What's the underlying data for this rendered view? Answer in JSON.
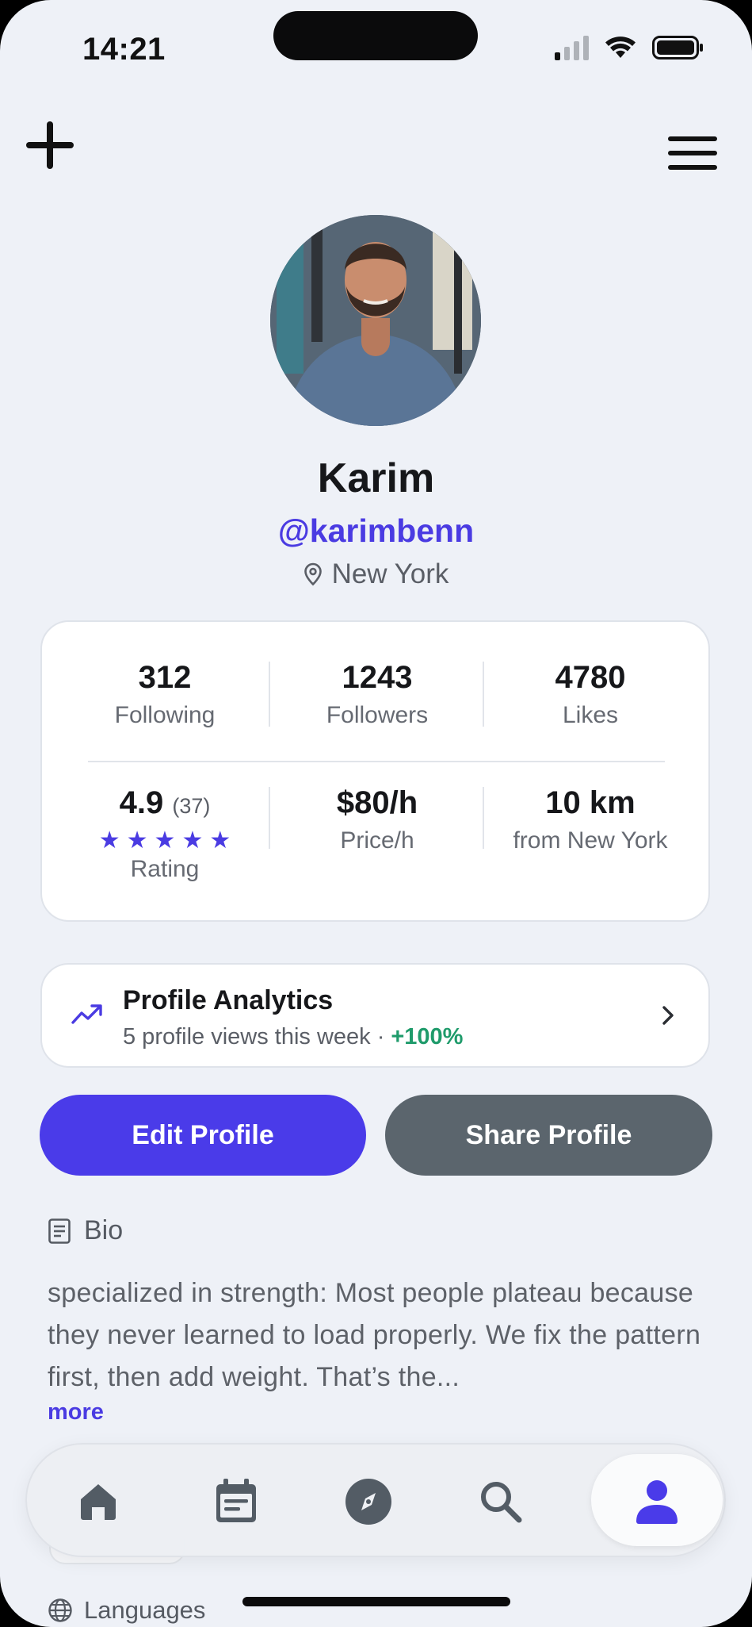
{
  "status_bar": {
    "time": "14:21"
  },
  "profile": {
    "name": "Karim",
    "handle": "@karimbenn",
    "location": "New York"
  },
  "stats": {
    "following": {
      "value": "312",
      "label": "Following"
    },
    "followers": {
      "value": "1243",
      "label": "Followers"
    },
    "likes": {
      "value": "4780",
      "label": "Likes"
    },
    "rating": {
      "value": "4.9",
      "count": "(37)",
      "label": "Rating",
      "stars": 5
    },
    "price": {
      "value": "$80/h",
      "label": "Price/h"
    },
    "distance": {
      "value": "10 km",
      "label": "from New York"
    }
  },
  "analytics": {
    "title": "Profile Analytics",
    "subtitle": "5 profile views this week",
    "separator": "·",
    "growth": "+100%",
    "growth_color": "#1f9b6b"
  },
  "buttons": {
    "edit": "Edit Profile",
    "share": "Share Profile"
  },
  "bio": {
    "heading": "Bio",
    "text": "specialized in strength: Most people plateau because they never learned to load properly. We fix the pattern first, then add weight. That’s the...",
    "more": "more"
  },
  "languages": {
    "heading": "Languages"
  },
  "tabbar": {
    "items": [
      {
        "icon": "home-icon"
      },
      {
        "icon": "calendar-icon"
      },
      {
        "icon": "compass-icon"
      },
      {
        "icon": "search-icon"
      },
      {
        "icon": "profile-icon",
        "active": true
      }
    ]
  },
  "colors": {
    "accent": "#4a3be2",
    "share_button": "#5b656d",
    "background": "#eef1f7"
  }
}
